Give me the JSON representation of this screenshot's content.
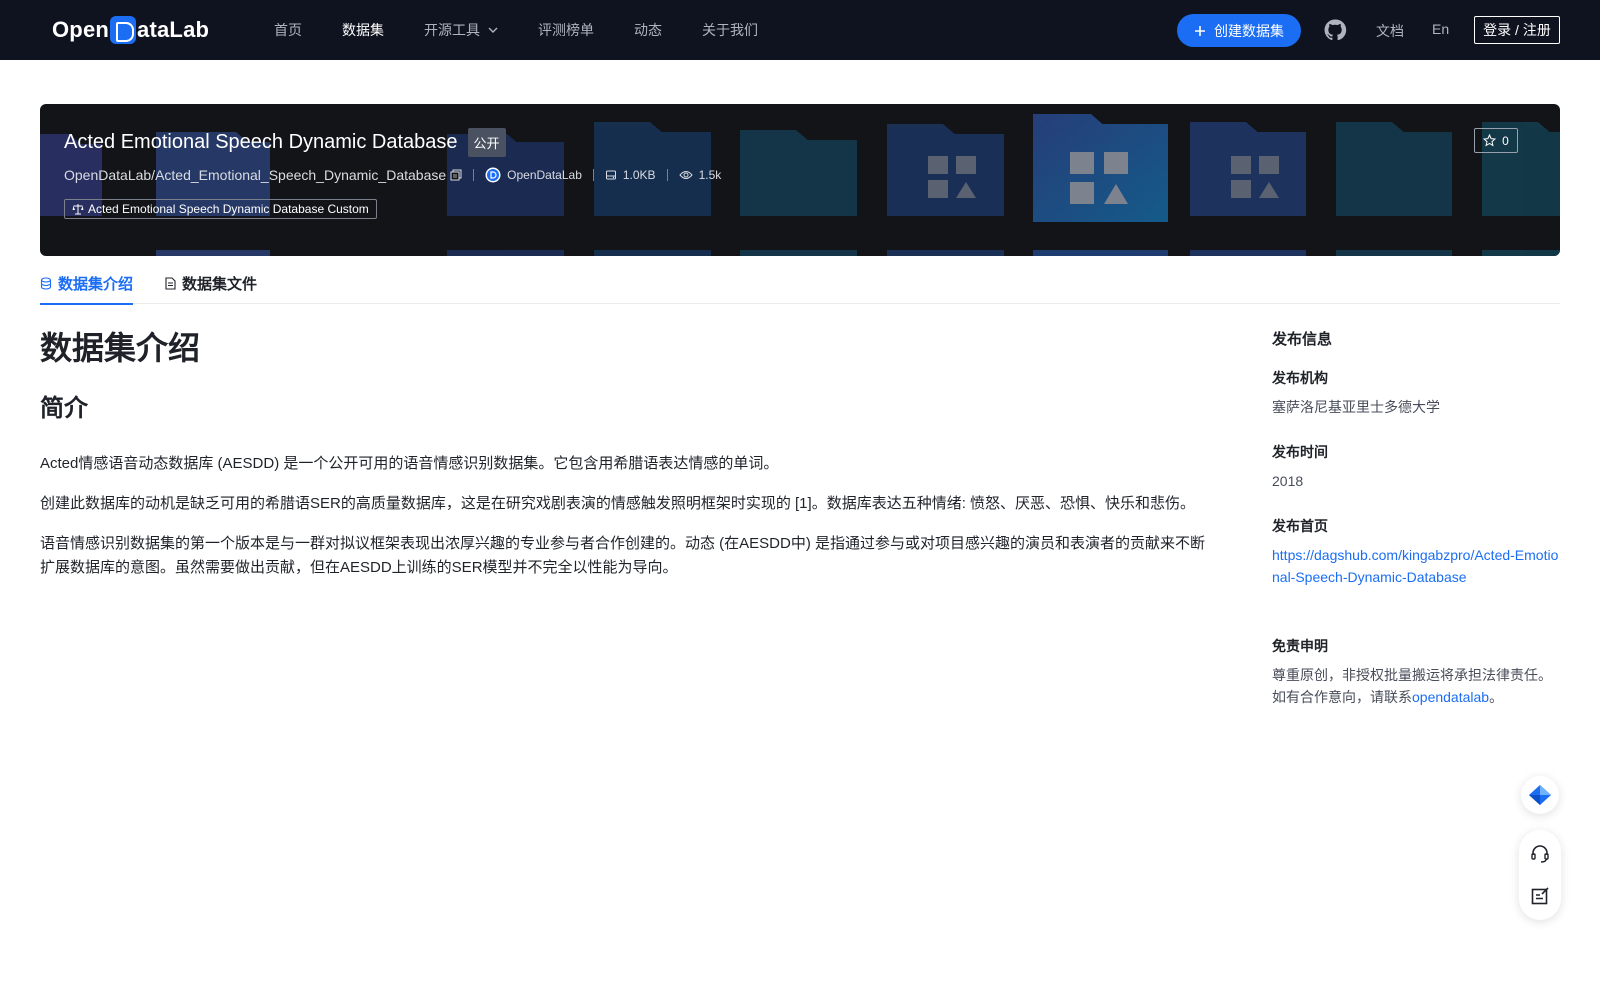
{
  "nav": {
    "logo_text_left": "Open",
    "logo_text_right": "ataLab",
    "links": [
      {
        "label": "首页"
      },
      {
        "label": "数据集"
      },
      {
        "label": "开源工具"
      },
      {
        "label": "评测榜单"
      },
      {
        "label": "动态"
      },
      {
        "label": "关于我们"
      }
    ],
    "create_label": "创建数据集",
    "docs_label": "文档",
    "lang_label": "En",
    "login_label": "登录 / 注册"
  },
  "banner": {
    "title": "Acted Emotional Speech Dynamic Database",
    "visibility": "公开",
    "path": "OpenDataLab/Acted_Emotional_Speech_Dynamic_Database",
    "org": "OpenDataLab",
    "size": "1.0KB",
    "views": "1.5k",
    "license": "Acted Emotional Speech Dynamic Database Custom",
    "stars": "0"
  },
  "tabs": [
    {
      "label": "数据集介绍"
    },
    {
      "label": "数据集文件"
    }
  ],
  "content": {
    "heading": "数据集介绍",
    "subheading": "简介",
    "paragraphs": [
      "Acted情感语音动态数据库 (AESDD) 是一个公开可用的语音情感识别数据集。它包含用希腊语表达情感的单词。",
      "创建此数据库的动机是缺乏可用的希腊语SER的高质量数据库，这是在研究戏剧表演的情感触发照明框架时实现的 [1]。数据库表达五种情绪: 愤怒、厌恶、恐惧、快乐和悲伤。",
      "语音情感识别数据集的第一个版本是与一群对拟议框架表现出浓厚兴趣的专业参与者合作创建的。动态 (在AESDD中) 是指通过参与或对项目感兴趣的演员和表演者的贡献来不断扩展数据库的意图。虽然需要做出贡献，但在AESDD上训练的SER模型并不完全以性能为导向。"
    ]
  },
  "sidebar": {
    "title": "发布信息",
    "org_label": "发布机构",
    "org_value": "塞萨洛尼基亚里士多德大学",
    "time_label": "发布时间",
    "time_value": "2018",
    "home_label": "发布首页",
    "home_value": "https://dagshub.com/kingabzpro/Acted-Emotional-Speech-Dynamic-Database",
    "disclaimer_label": "免责申明",
    "disclaimer_line1": "尊重原创，非授权批量搬运将承担法律责任。",
    "disclaimer_line2_prefix": "如有合作意向，请联系",
    "disclaimer_link": "opendatalab",
    "disclaimer_line2_suffix": "。"
  },
  "icons": {
    "create": "plus-icon",
    "github": "github-icon",
    "star": "star-icon",
    "float_top": "logo-diamond-icon",
    "support": "headset-icon",
    "feedback": "edit-note-icon"
  },
  "colors": {
    "nav_bg": "#0f1320",
    "accent": "#1b6ef3",
    "banner_bg": "#121418"
  }
}
